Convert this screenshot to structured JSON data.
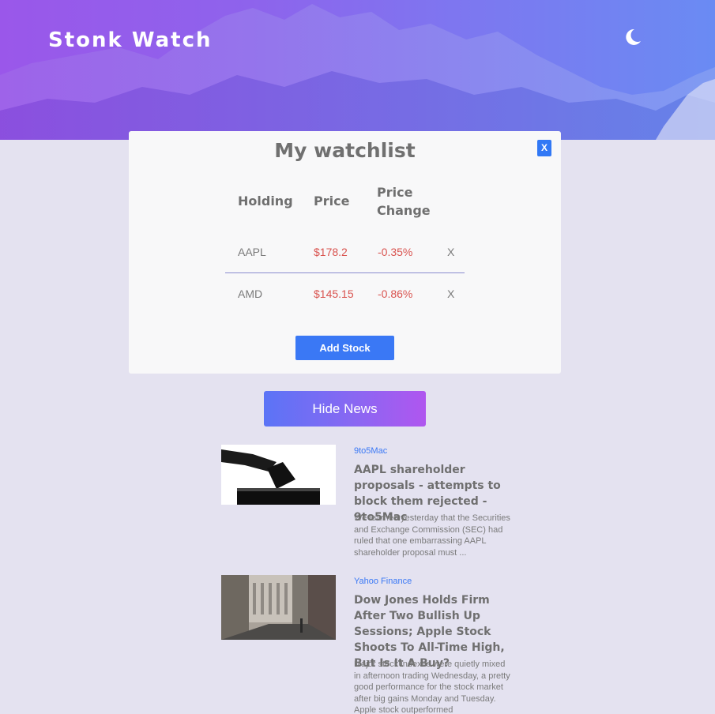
{
  "app": {
    "brand": "Stonk Watch",
    "theme_icon": "moon-icon"
  },
  "watchlist": {
    "title": "My watchlist",
    "close_label": "X",
    "headers": {
      "holding": "Holding",
      "price": "Price",
      "change_line1": "Price",
      "change_line2": "Change"
    },
    "rows": [
      {
        "holding": "AAPL",
        "price": "$178.2",
        "change": "-0.35%",
        "remove": "X"
      },
      {
        "holding": "AMD",
        "price": "$145.15",
        "change": "-0.86%",
        "remove": "X"
      }
    ],
    "add_label": "Add Stock"
  },
  "news": {
    "toggle_label": "Hide News",
    "items": [
      {
        "source": "9to5Mac",
        "title": "AAPL shareholder proposals - attempts to block them rejected - 9to5Mac",
        "description": "We learned yesterday that the Securities and Exchange Commission (SEC) had ruled that one embarrassing AAPL shareholder proposal must ..."
      },
      {
        "source": "Yahoo Finance",
        "title": "Dow Jones Holds Firm After Two Bullish Up Sessions; Apple Stock Shoots To All-Time High, But Is It A Buy?",
        "description": "Major stock indexes were quietly mixed in afternoon trading Wednesday, a pretty good performance for the stock market after big gains Monday and Tuesday. Apple stock outperformed"
      }
    ]
  },
  "colors": {
    "accent": "#3a78f5",
    "negative": "#d9534f",
    "page_bg": "#e4e2f0"
  }
}
